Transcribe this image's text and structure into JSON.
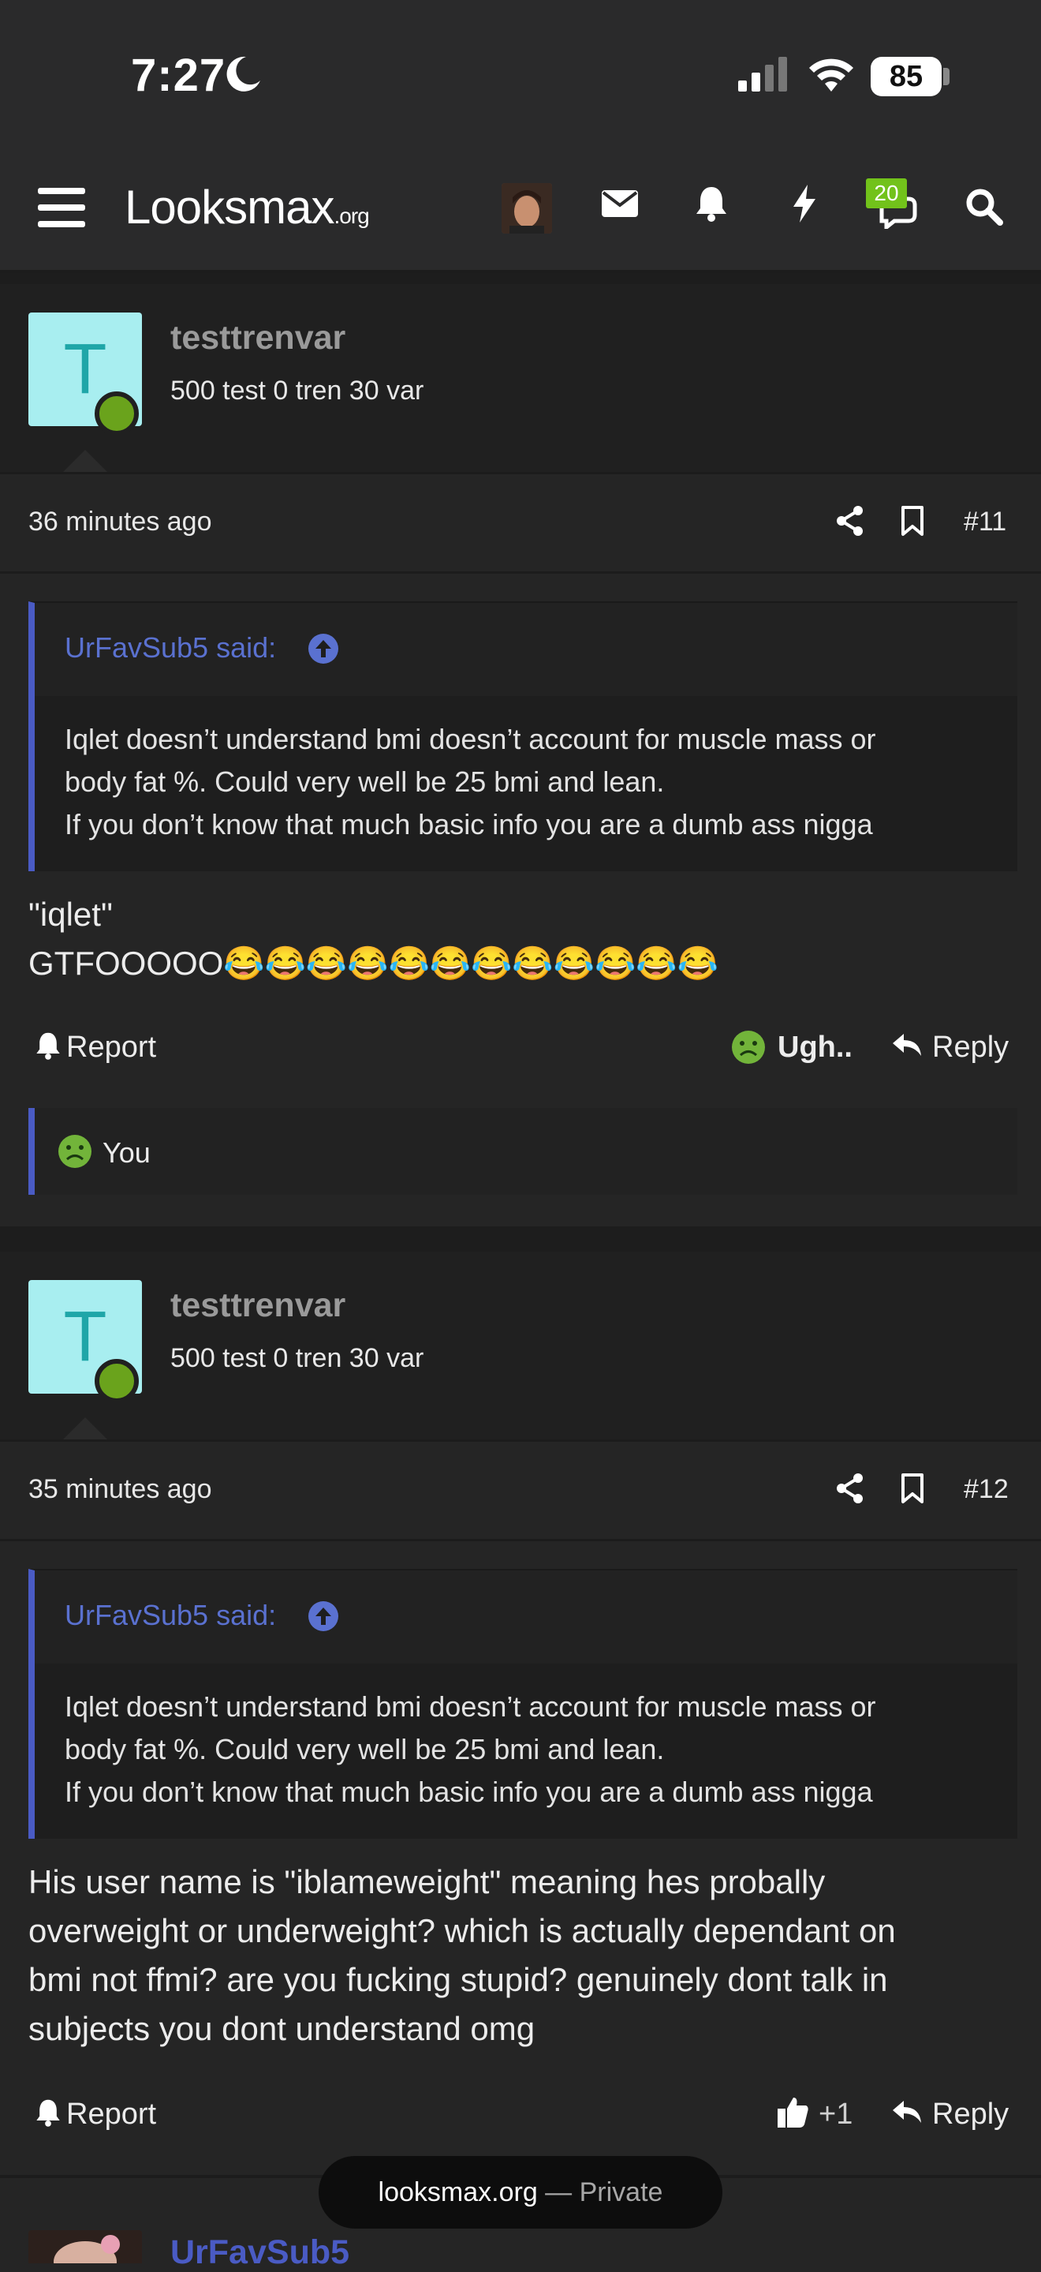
{
  "status": {
    "time": "7:27",
    "battery": "85"
  },
  "nav": {
    "logo_main": "Looksmax",
    "logo_suffix": ".org",
    "badge_count": "20"
  },
  "posts": [
    {
      "username": "testtrenvar",
      "avatar_letter": "T",
      "user_title": "500 test 0 tren 30 var",
      "time": "36 minutes ago",
      "number": "#11",
      "quote_author": "UrFavSub5 said:",
      "quote_lines": [
        "Iqlet doesn’t understand bmi doesn’t account for muscle mass or",
        "body fat %. Could very well be 25 bmi and lean.",
        "If you don’t know that much basic info you are a dumb ass nigga"
      ],
      "content_lines": [
        "\"iqlet\"",
        "GTFOOOOO😂😂😂😂😂😂😂😂😂😂😂😂"
      ],
      "report_label": "Report",
      "reaction_label": "Ugh..",
      "reply_label": "Reply",
      "reacted_by": "You"
    },
    {
      "username": "testtrenvar",
      "avatar_letter": "T",
      "user_title": "500 test 0 tren 30 var",
      "time": "35 minutes ago",
      "number": "#12",
      "quote_author": "UrFavSub5 said:",
      "quote_lines": [
        "Iqlet doesn’t understand bmi doesn’t account for muscle mass or",
        "body fat %. Could very well be 25 bmi and lean.",
        "If you don’t know that much basic info you are a dumb ass nigga"
      ],
      "content_lines": [
        "His user name is \"iblameweight\" meaning hes probally",
        "overweight or underweight? which is actually dependant on",
        "bmi not ffmi? are you fucking stupid? genuinely dont talk in",
        "subjects you dont understand omg"
      ],
      "report_label": "Report",
      "like_label": "+1",
      "reply_label": "Reply"
    }
  ],
  "next_post": {
    "username": "UrFavSub5"
  },
  "toast": {
    "domain": "looksmax.org",
    "suffix": " — Private"
  },
  "colors": {
    "accent": "#5a71d0",
    "online": "#6aa31c",
    "avatar_bg": "#a8eef0",
    "badge": "#72c21b"
  }
}
